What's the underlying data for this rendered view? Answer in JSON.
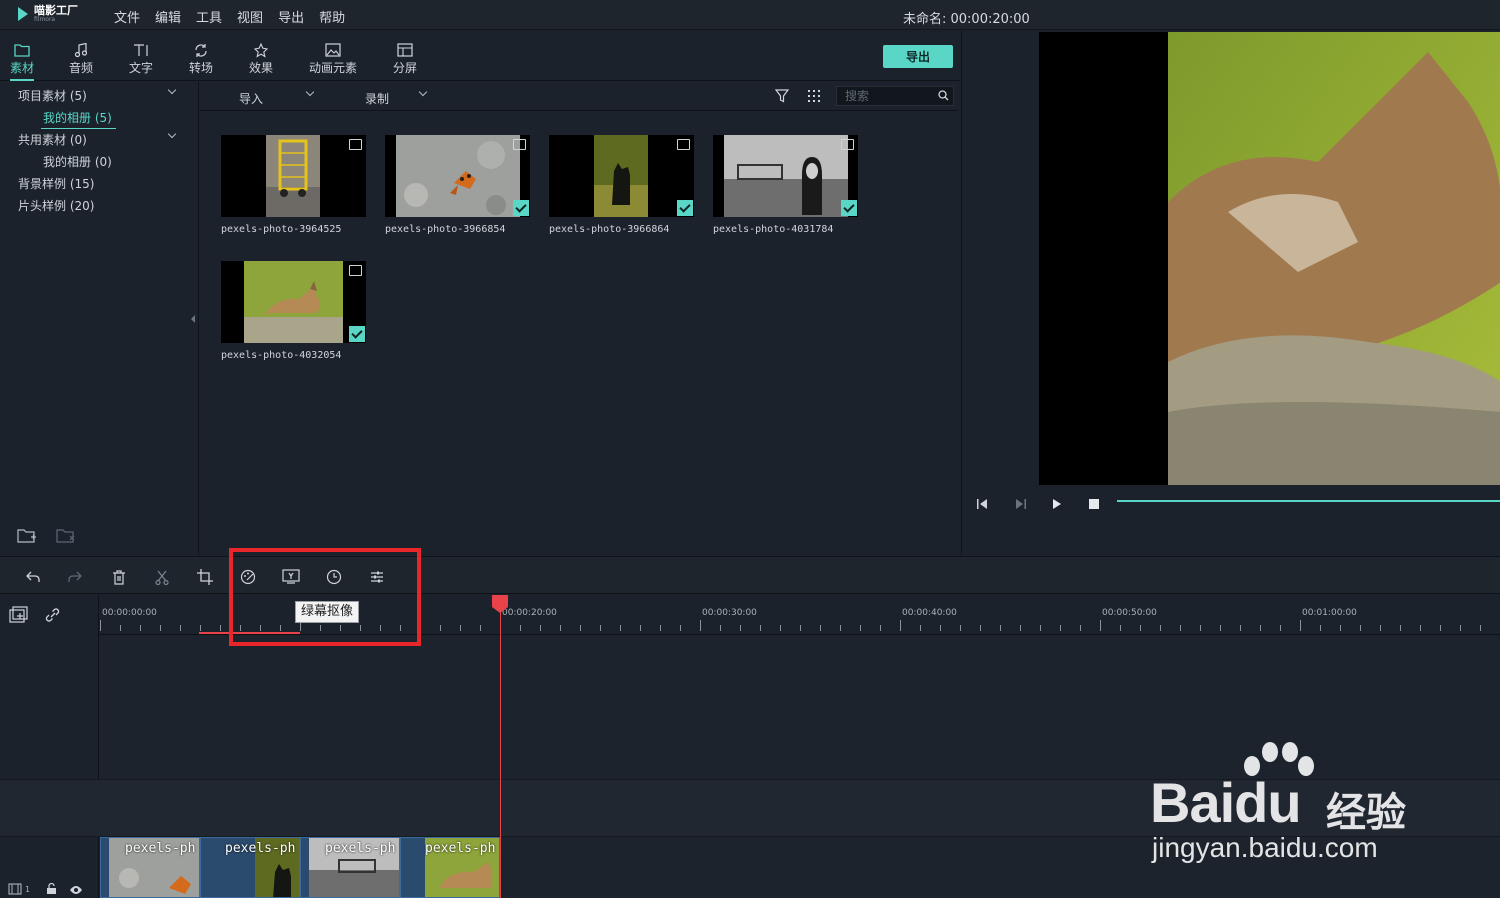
{
  "app": {
    "logo_cn": "喵影工厂",
    "logo_en": "filmora",
    "menu": [
      "文件",
      "编辑",
      "工具",
      "视图",
      "导出",
      "帮助"
    ],
    "project_title": "未命名: 00:00:20:00"
  },
  "tabs": [
    {
      "label": "素材",
      "icon": "folder-icon",
      "active": true
    },
    {
      "label": "音频",
      "icon": "music-note-icon"
    },
    {
      "label": "文字",
      "icon": "text-icon"
    },
    {
      "label": "转场",
      "icon": "transition-icon"
    },
    {
      "label": "效果",
      "icon": "effects-icon"
    },
    {
      "label": "动画元素",
      "icon": "image-icon"
    },
    {
      "label": "分屏",
      "icon": "split-screen-icon"
    }
  ],
  "export_label": "导出",
  "sidebar": {
    "items": [
      {
        "label": "项目素材 (5)"
      },
      {
        "label": "我的相册 (5)",
        "active": true
      },
      {
        "label": "共用素材 (0)"
      },
      {
        "label": "我的相册 (0)"
      },
      {
        "label": "背景样例 (15)"
      },
      {
        "label": "片头样例 (20)"
      }
    ]
  },
  "media_toolbar": {
    "import_label": "导入",
    "record_label": "录制",
    "search_placeholder": "搜索"
  },
  "media": [
    {
      "name": "pexels-photo-3964525",
      "checked": false
    },
    {
      "name": "pexels-photo-3966854",
      "checked": true
    },
    {
      "name": "pexels-photo-3966864",
      "checked": true
    },
    {
      "name": "pexels-photo-4031784",
      "checked": true
    },
    {
      "name": "pexels-photo-4032054",
      "checked": true
    }
  ],
  "timeline": {
    "tooltip": "绿幕抠像",
    "ruler_labels": [
      "00:00:00:00",
      "00:00:20:00",
      "00:00:30:00",
      "00:00:40:00",
      "00:00:50:00",
      "00:01:00:00"
    ],
    "track_number": "1",
    "clips": [
      {
        "label": "pexels-ph"
      },
      {
        "label": "pexels-ph"
      },
      {
        "label": "pexels-ph"
      },
      {
        "label": "pexels-ph"
      }
    ]
  },
  "watermark": {
    "brand": "Bai",
    "brand_paw": "du",
    "cn": "经验",
    "url": "jingyan.baidu.com"
  },
  "colors": {
    "accent": "#5ad6c6",
    "playhead": "#e8424a",
    "highlight": "#e8262b",
    "background": "#1b222b"
  }
}
